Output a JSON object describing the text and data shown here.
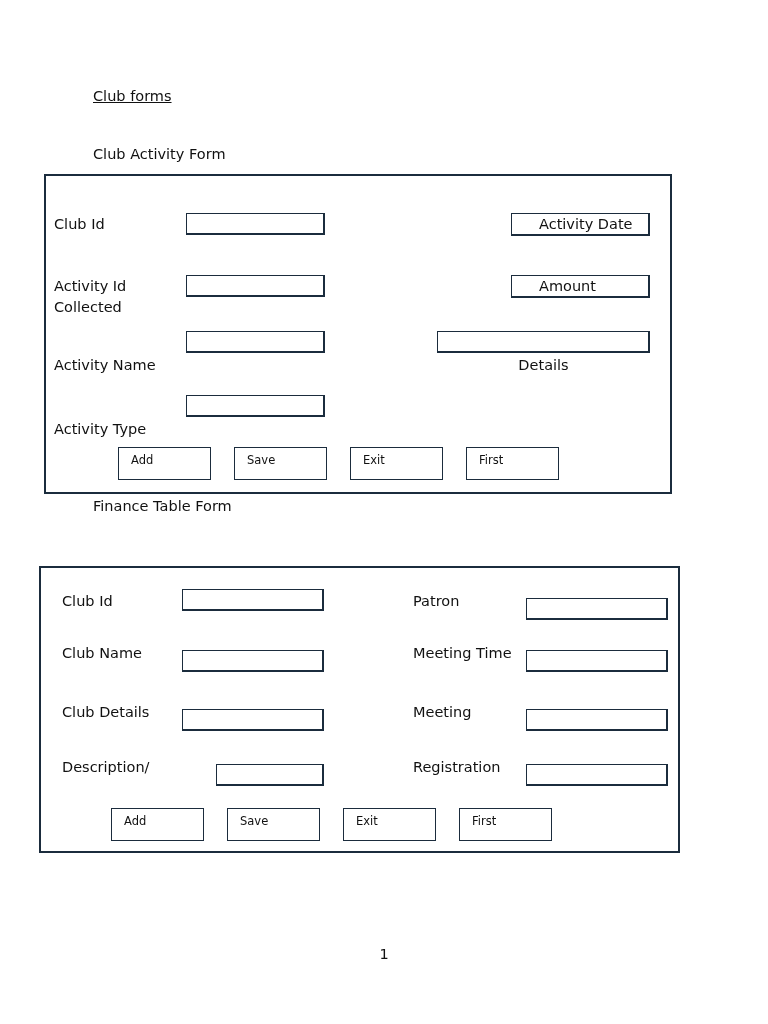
{
  "heading": "Club forms",
  "forms": [
    {
      "title": "Club Activity Form",
      "left_fields": [
        {
          "kind": "beside",
          "label": "Club Id"
        },
        {
          "kind": "beside",
          "label": "Activity Id",
          "note": "Collected"
        },
        {
          "kind": "below_left",
          "label": "Activity Name"
        },
        {
          "kind": "below_left",
          "label": "Activity Type"
        }
      ],
      "right_fields": [
        {
          "kind": "boxed",
          "label": "Activity Date"
        },
        {
          "kind": "boxed",
          "label": "Amount"
        },
        {
          "kind": "under",
          "label": "Details"
        }
      ],
      "buttons": [
        "Add",
        "Save",
        "Exit",
        "First"
      ]
    },
    {
      "title": "Finance Table Form",
      "left_fields": [
        {
          "kind": "beside",
          "label": "Club Id"
        },
        {
          "kind": "beside",
          "label": "Club Name"
        },
        {
          "kind": "beside",
          "label": "Club Details"
        },
        {
          "kind": "beside",
          "label": "Description/"
        }
      ],
      "right_fields": [
        {
          "kind": "beside",
          "label": "Patron"
        },
        {
          "kind": "beside",
          "label": "Meeting Time"
        },
        {
          "kind": "beside",
          "label": "Meeting"
        },
        {
          "kind": "beside",
          "label": "Registration"
        }
      ],
      "buttons": [
        "Add",
        "Save",
        "Exit",
        "First"
      ]
    }
  ],
  "page_number": "1"
}
